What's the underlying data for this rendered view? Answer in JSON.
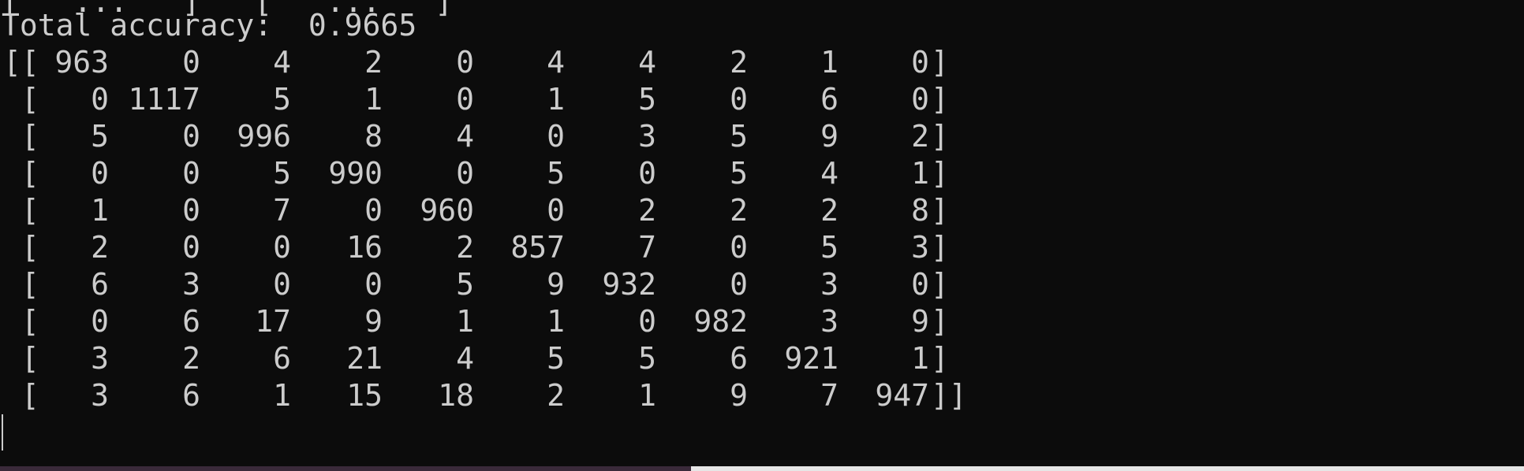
{
  "terminal": {
    "partial_line": "[   ...   ]   [   ...   ]",
    "accuracy_label": "Total accuracy:  0.9665"
  },
  "confusion_matrix": {
    "rows": [
      {
        "open": "[[",
        "values": [
          "963",
          "0",
          "4",
          "2",
          "0",
          "4",
          "4",
          "2",
          "1",
          "0"
        ],
        "close": "]"
      },
      {
        "open": " [",
        "values": [
          "0",
          "1117",
          "5",
          "1",
          "0",
          "1",
          "5",
          "0",
          "6",
          "0"
        ],
        "close": "]"
      },
      {
        "open": " [",
        "values": [
          "5",
          "0",
          "996",
          "8",
          "4",
          "0",
          "3",
          "5",
          "9",
          "2"
        ],
        "close": "]"
      },
      {
        "open": " [",
        "values": [
          "0",
          "0",
          "5",
          "990",
          "0",
          "5",
          "0",
          "5",
          "4",
          "1"
        ],
        "close": "]"
      },
      {
        "open": " [",
        "values": [
          "1",
          "0",
          "7",
          "0",
          "960",
          "0",
          "2",
          "2",
          "2",
          "8"
        ],
        "close": "]"
      },
      {
        "open": " [",
        "values": [
          "2",
          "0",
          "0",
          "16",
          "2",
          "857",
          "7",
          "0",
          "5",
          "3"
        ],
        "close": "]"
      },
      {
        "open": " [",
        "values": [
          "6",
          "3",
          "0",
          "0",
          "5",
          "9",
          "932",
          "0",
          "3",
          "0"
        ],
        "close": "]"
      },
      {
        "open": " [",
        "values": [
          "0",
          "6",
          "17",
          "9",
          "1",
          "1",
          "0",
          "982",
          "3",
          "9"
        ],
        "close": "]"
      },
      {
        "open": " [",
        "values": [
          "3",
          "2",
          "6",
          "21",
          "4",
          "5",
          "5",
          "6",
          "921",
          "1"
        ],
        "close": "]"
      },
      {
        "open": " [",
        "values": [
          "3",
          "6",
          "1",
          "15",
          "18",
          "2",
          "1",
          "9",
          "7",
          "947"
        ],
        "close": "]]"
      }
    ]
  },
  "colors": {
    "background": "#0c0c0c",
    "foreground": "#cccccc"
  }
}
